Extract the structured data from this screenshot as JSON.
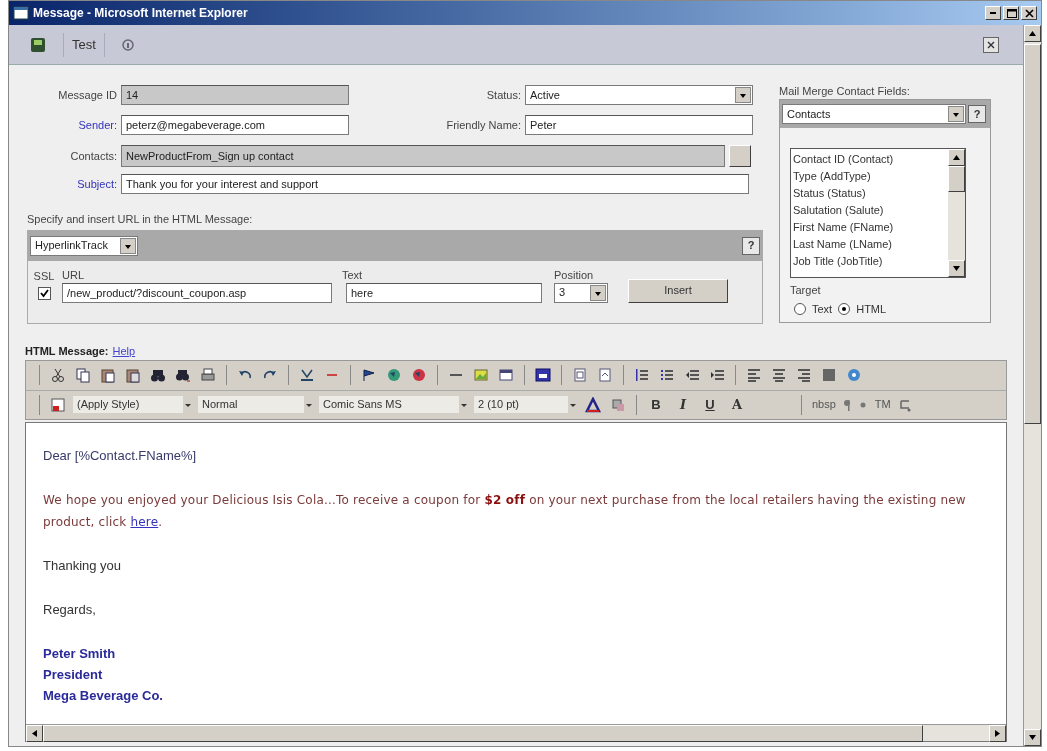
{
  "window": {
    "title": "Message - Microsoft Internet Explorer"
  },
  "toolbar": {
    "test_label": "Test"
  },
  "form": {
    "message_id": {
      "label": "Message ID",
      "value": "14"
    },
    "status": {
      "label": "Status:",
      "value": "Active"
    },
    "sender": {
      "label": "Sender:",
      "value": "peterz@megabeverage.com"
    },
    "friendly_name": {
      "label": "Friendly Name:",
      "value": "Peter"
    },
    "contacts": {
      "label": "Contacts:",
      "value": "NewProductFrom_Sign up contact"
    },
    "subject": {
      "label": "Subject:",
      "value": "Thank you for your interest and support"
    }
  },
  "url_insert": {
    "heading": "Specify and insert URL in the HTML Message:",
    "link_type": "HyperlinkTrack",
    "help": "?",
    "ssl": {
      "label": "SSL",
      "checked": true
    },
    "url": {
      "label": "URL",
      "value": "/new_product/?discount_coupon.asp"
    },
    "text": {
      "label": "Text",
      "value": "here"
    },
    "position": {
      "label": "Position",
      "value": "3"
    },
    "insert_button": "Insert"
  },
  "mail_merge": {
    "heading": "Mail Merge Contact Fields:",
    "source": "Contacts",
    "help": "?",
    "fields": [
      "Contact ID (Contact)",
      "Type (AddType)",
      "Status (Status)",
      "Salutation (Salute)",
      "First Name (FName)",
      "Last Name (LName)",
      "Job Title (JobTitle)"
    ],
    "target_label": "Target",
    "targets": [
      {
        "label": "Text",
        "selected": false
      },
      {
        "label": "HTML",
        "selected": true
      }
    ]
  },
  "editor": {
    "label": "HTML Message:",
    "help_link": "Help",
    "style": "(Apply Style)",
    "paragraph": "Normal",
    "font": "Comic Sans MS",
    "size": "2 (10 pt)",
    "format_buttons": [
      "B",
      "I",
      "U",
      "A"
    ],
    "special": [
      "nbsp",
      "TM"
    ],
    "body": [
      {
        "kind": "greeting",
        "text": "Dear [%Contact.FName%]"
      },
      {
        "kind": "offer",
        "text": "We hope you enjoyed your Delicious Isis Cola...To receive a coupon for **$2 off** on your next purchase from the local retailers having the existing new product, click ",
        "link": "here",
        "after": "."
      },
      {
        "kind": "plain",
        "text": "Thanking you"
      },
      {
        "kind": "plain",
        "text": "Regards,"
      },
      {
        "kind": "signature",
        "lines": [
          "Peter Smith",
          "President",
          "Mega Beverage Co."
        ]
      }
    ]
  }
}
